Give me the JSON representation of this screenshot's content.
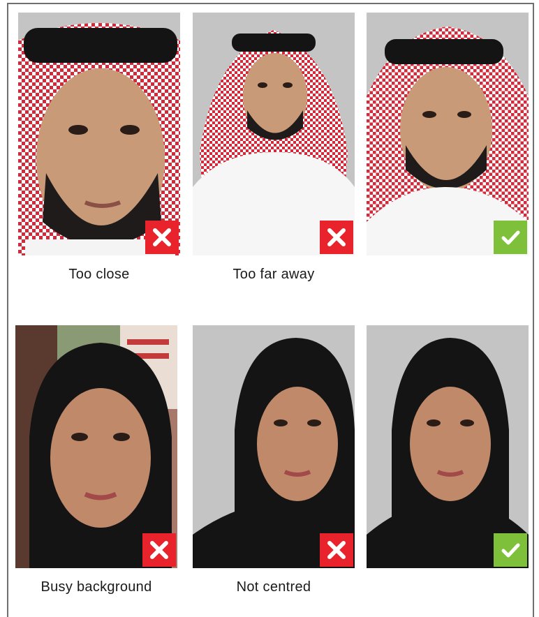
{
  "rows": [
    {
      "subject": "man-in-ghutra",
      "cells": [
        {
          "verdict": "incorrect",
          "badge_icon": "cross-icon",
          "caption": "Too close"
        },
        {
          "verdict": "incorrect",
          "badge_icon": "cross-icon",
          "caption": "Too far away"
        },
        {
          "verdict": "correct",
          "badge_icon": "check-icon",
          "caption": ""
        }
      ]
    },
    {
      "subject": "woman-in-hijab",
      "cells": [
        {
          "verdict": "incorrect",
          "badge_icon": "cross-icon",
          "caption": "Busy background"
        },
        {
          "verdict": "incorrect",
          "badge_icon": "cross-icon",
          "caption": "Not centred"
        },
        {
          "verdict": "correct",
          "badge_icon": "check-icon",
          "caption": ""
        }
      ]
    }
  ],
  "colors": {
    "incorrect_badge": "#e8232b",
    "correct_badge": "#7fc03a",
    "photo_background": "#bcbcbc",
    "frame_border": "#6f6f6f"
  }
}
